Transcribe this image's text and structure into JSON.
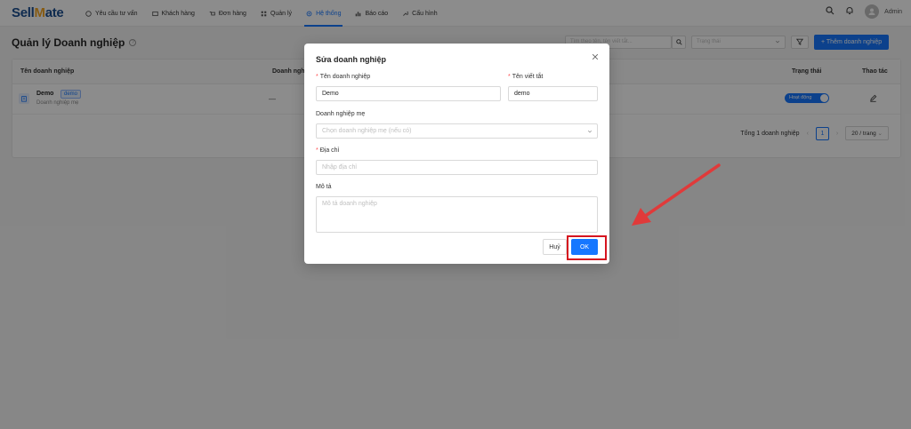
{
  "app": {
    "logo_prefix": "Sell",
    "logo_m": "M",
    "logo_suffix": "ate"
  },
  "nav": {
    "items": [
      {
        "label": "Yêu cầu tư vấn",
        "icon": "chat-icon"
      },
      {
        "label": "Khách hàng",
        "icon": "contacts-icon"
      },
      {
        "label": "Đơn hàng",
        "icon": "cart-icon"
      },
      {
        "label": "Quản lý",
        "icon": "grid-icon"
      },
      {
        "label": "Hệ thống",
        "icon": "gear-icon",
        "active": true
      },
      {
        "label": "Báo cáo",
        "icon": "bar-chart-icon"
      },
      {
        "label": "Cấu hình",
        "icon": "wrench-icon"
      }
    ],
    "user_name": "Admin"
  },
  "page": {
    "title": "Quản lý Doanh nghiệp",
    "search_placeholder": "Tìm theo tên, tên viết tắt...",
    "status_placeholder": "Trạng thái",
    "add_button": "+ Thêm doanh nghiệp"
  },
  "table": {
    "columns": [
      "Tên doanh nghiệp",
      "Doanh ngh",
      "Trạng thái",
      "Thao tác"
    ],
    "rows": [
      {
        "name": "Demo",
        "tag": "demo",
        "sub": "Doanh nghiệp mẹ",
        "parent": "—",
        "status": "Hoạt động"
      }
    ],
    "total_text": "Tổng 1 doanh nghiệp",
    "current_page": "1",
    "page_size": "20 / trang"
  },
  "modal": {
    "title": "Sửa doanh nghiệp",
    "name_label": "Tên doanh nghiệp",
    "name_value": "Demo",
    "short_label": "Tên viết tắt",
    "short_value": "demo",
    "parent_label": "Doanh nghiệp mẹ",
    "parent_placeholder": "Chọn doanh nghiệp mẹ (nếu có)",
    "address_label": "Địa chỉ",
    "address_placeholder": "Nhập địa chỉ",
    "desc_label": "Mô tả",
    "desc_placeholder": "Mô tả doanh nghiệp",
    "cancel_label": "Huỷ",
    "ok_label": "OK"
  },
  "colors": {
    "primary": "#1677ff",
    "highlight": "#d6141f",
    "arrow": "#e03a3a"
  }
}
